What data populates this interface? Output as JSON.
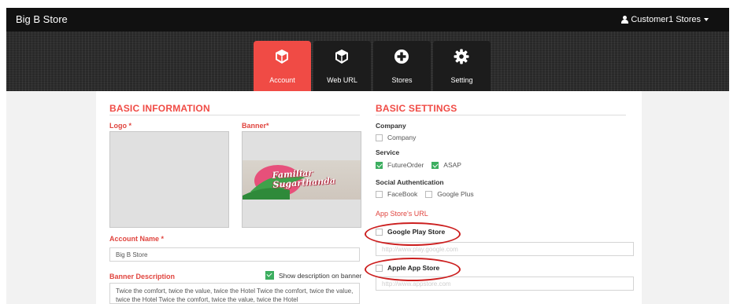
{
  "topbar": {
    "brand": "Big B Store",
    "user_label": "Customer1 Stores"
  },
  "tabs": [
    {
      "label": "Account",
      "icon": "box-icon",
      "active": true
    },
    {
      "label": "Web URL",
      "icon": "cube-icon",
      "active": false
    },
    {
      "label": "Stores",
      "icon": "plus-circle-icon",
      "active": false
    },
    {
      "label": "Setting",
      "icon": "gear-icon",
      "active": false
    }
  ],
  "basic_info": {
    "title": "BASIC INFORMATION",
    "logo_label": "Logo *",
    "banner_label": "Banner*",
    "banner_image_text": "Familiar Sugarthanda",
    "account_name_label": "Account Name *",
    "account_name_value": "Big B Store",
    "banner_desc_label": "Banner Description",
    "show_desc_label": "Show description on banner",
    "banner_desc_value": "Twice the comfort, twice the value, twice the Hotel Twice the comfort, twice the value, twice the Hotel Twice the comfort, twice the value, twice the Hotel"
  },
  "basic_settings": {
    "title": "BASIC SETTINGS",
    "company_group": "Company",
    "company_option": "Company",
    "service_group": "Service",
    "future_order": "FutureOrder",
    "asap": "ASAP",
    "social_group": "Social Authentication",
    "facebook": "FaceBook",
    "google_plus": "Google Plus",
    "app_store_url_label": "App Store's URL",
    "google_play_label": "Google Play Store",
    "google_play_placeholder": "http://www.play.google.com",
    "apple_label": "Apple App Store",
    "apple_placeholder": "http://www.appstore.com"
  },
  "colors": {
    "accent": "#f04b45",
    "check_green": "#3cae5f",
    "annotation_red": "#cc1f1f"
  }
}
